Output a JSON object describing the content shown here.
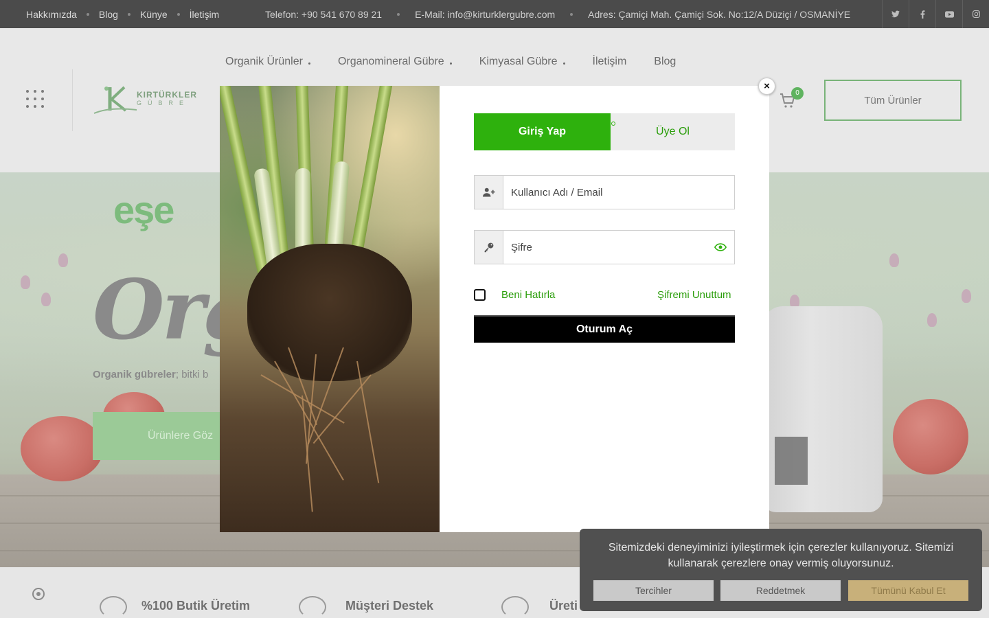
{
  "topbar": {
    "links": [
      "Hakkımızda",
      "Blog",
      "Künye",
      "İletişim"
    ],
    "phone": "Telefon: +90 541 670 89 21",
    "email": "E-Mail: info@kirturklergubre.com",
    "address": "Adres: Çamiçi Mah. Çamiçi Sok. No:12/A Düziçi / OSMANİYE",
    "social_icons": [
      "twitter-icon",
      "facebook-icon",
      "youtube-icon",
      "instagram-icon"
    ]
  },
  "header": {
    "logo_name": "KIRTÜRKLER",
    "logo_sub": "GÜBRE",
    "nav": [
      "Organik Ürünler",
      "Organomineral Gübre",
      "Kimyasal Gübre",
      "İletişim",
      "Blog"
    ],
    "cart_count": "0",
    "all_products": "Tüm Ürünler"
  },
  "hero": {
    "brand": "eşe",
    "title": "Orga",
    "tagline_bold": "Organik gübreler",
    "tagline_rest": "; bitki b",
    "cta": "Ürünlere Göz"
  },
  "features": [
    "%100 Butik Üretim",
    "Müşteri Destek",
    "Üreti"
  ],
  "modal": {
    "tab_login": "Giriş Yap",
    "tab_register": "Üye Ol",
    "username_placeholder": "Kullanıcı Adı / Email",
    "password_placeholder": "Şifre",
    "remember": "Beni Hatırla",
    "forgot": "Şifremi Unuttum",
    "submit": "Oturum Aç",
    "close": "×"
  },
  "cookie": {
    "message": "Sitemizdeki deneyiminizi iyileştirmek için çerezler kullanıyoruz. Sitemizi kullanarak çerezlere onay vermiş oluyorsunuz.",
    "preferences": "Tercihler",
    "reject": "Reddetmek",
    "accept_all": "Tümünü Kabul Et"
  },
  "colors": {
    "accent_green": "#2eb10d",
    "link_green": "#2a9d0a",
    "topbar_bg": "#4b4b4b",
    "cookie_bg": "#505050",
    "accept_gold": "#c8b07a"
  }
}
